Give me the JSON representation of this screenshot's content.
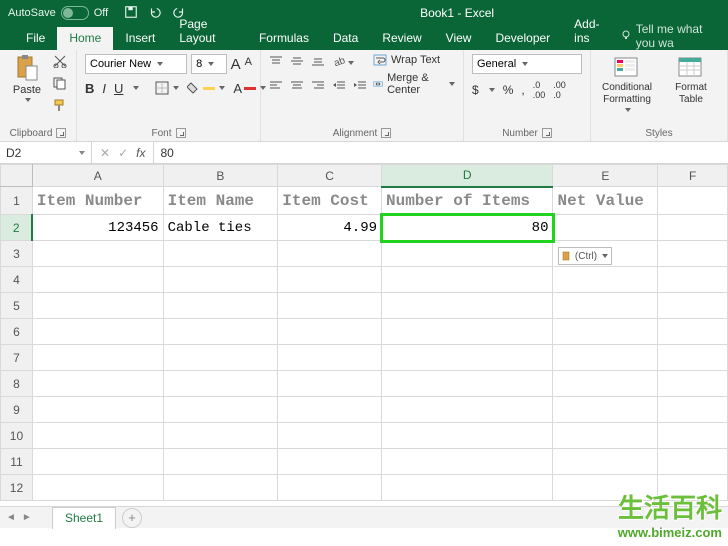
{
  "window": {
    "autosave": "AutoSave",
    "autosave_state": "Off",
    "title": "Book1  -  Excel"
  },
  "tabs": {
    "file": "File",
    "home": "Home",
    "insert": "Insert",
    "page_layout": "Page Layout",
    "formulas": "Formulas",
    "data": "Data",
    "review": "Review",
    "view": "View",
    "developer": "Developer",
    "addins": "Add-ins",
    "tellme": "Tell me what you wa"
  },
  "ribbon": {
    "clipboard": {
      "paste": "Paste",
      "label": "Clipboard"
    },
    "font": {
      "name": "Courier New",
      "size": "8",
      "label": "Font",
      "bold": "B",
      "italic": "I",
      "underline": "U"
    },
    "alignment": {
      "wrap": "Wrap Text",
      "merge": "Merge & Center",
      "label": "Alignment"
    },
    "number": {
      "format": "General",
      "label": "Number",
      "currency": "$",
      "percent": "%",
      "comma": ",",
      "inc": ".0→.00",
      "dec": ".00→.0"
    },
    "styles": {
      "cond": "Conditional\nFormatting",
      "table": "Format\nTable",
      "label": "Styles"
    }
  },
  "namebox": "D2",
  "formula": "80",
  "columns": {
    "A": "A",
    "B": "B",
    "C": "C",
    "D": "D",
    "E": "E",
    "F": "F"
  },
  "headers": {
    "a": "Item Number",
    "b": "Item Name",
    "c": "Item Cost",
    "d": "Number of Items",
    "e": "Net Value"
  },
  "row2": {
    "a": "123456",
    "b": "Cable ties",
    "c": "4.99",
    "d": "80"
  },
  "paste_tag": "(Ctrl)",
  "sheet": {
    "name": "Sheet1"
  },
  "watermark": {
    "cn": "生活百科",
    "url": "www.bimeiz.com"
  }
}
